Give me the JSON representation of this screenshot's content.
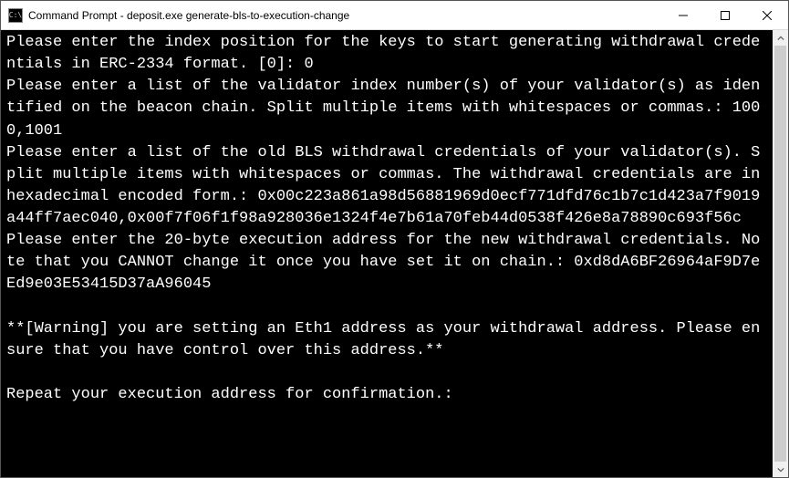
{
  "window": {
    "icon_label": "C:\\",
    "title": "Command Prompt - deposit.exe  generate-bls-to-execution-change"
  },
  "terminal": {
    "content": "Please enter the index position for the keys to start generating withdrawal credentials in ERC-2334 format. [0]: 0\nPlease enter a list of the validator index number(s) of your validator(s) as identified on the beacon chain. Split multiple items with whitespaces or commas.: 1000,1001\nPlease enter a list of the old BLS withdrawal credentials of your validator(s). Split multiple items with whitespaces or commas. The withdrawal credentials are in hexadecimal encoded form.: 0x00c223a861a98d56881969d0ecf771dfd76c1b7c1d423a7f9019a44ff7aec040,0x00f7f06f1f98a928036e1324f4e7b61a70feb44d0538f426e8a78890c693f56c\nPlease enter the 20-byte execution address for the new withdrawal credentials. Note that you CANNOT change it once you have set it on chain.: 0xd8dA6BF26964aF9D7eEd9e03E53415D37aA96045\n\n**[Warning] you are setting an Eth1 address as your withdrawal address. Please ensure that you have control over this address.**\n\nRepeat your execution address for confirmation.:"
  }
}
